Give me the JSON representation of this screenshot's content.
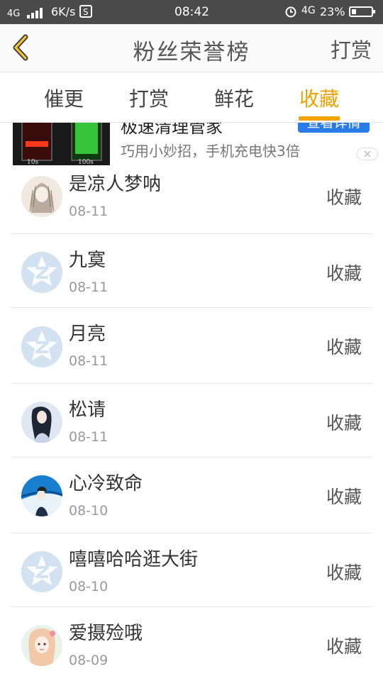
{
  "status_bar": {
    "network_left": "4G",
    "speed": "6K/s",
    "time": "08:42",
    "network_right": "4G",
    "battery": "23%",
    "battery_level": 0.23
  },
  "header": {
    "title": "粉丝荣誉榜",
    "right_action": "打赏"
  },
  "tabs": [
    {
      "label": "催更",
      "active": false
    },
    {
      "label": "打赏",
      "active": false
    },
    {
      "label": "鲜花",
      "active": false
    },
    {
      "label": "收藏",
      "active": true
    }
  ],
  "ad": {
    "title": "极速清理管家",
    "subtitle": "巧用小妙招，手机充电快3倍",
    "cta": "查看详情",
    "image_label_left": "10s",
    "image_label_right": "100s"
  },
  "rows": [
    {
      "name": "是凉人梦呐",
      "date": "08-11",
      "action": "收藏",
      "avatar": "photo"
    },
    {
      "name": "九寞",
      "date": "08-11",
      "action": "收藏",
      "avatar": "default"
    },
    {
      "name": "月亮",
      "date": "08-11",
      "action": "收藏",
      "avatar": "default"
    },
    {
      "name": "松请",
      "date": "08-11",
      "action": "收藏",
      "avatar": "photo"
    },
    {
      "name": "心冷致命",
      "date": "08-10",
      "action": "收藏",
      "avatar": "photo"
    },
    {
      "name": "嘻嘻哈哈逛大街",
      "date": "08-10",
      "action": "收藏",
      "avatar": "default"
    },
    {
      "name": "爱摄殓哦",
      "date": "08-09",
      "action": "收藏",
      "avatar": "photo"
    }
  ],
  "colors": {
    "accent": "#f0a000",
    "status_bar_bg": "#4a4a4a",
    "default_avatar": "#d2e2f0",
    "ad_cta": "#2a7be8"
  }
}
